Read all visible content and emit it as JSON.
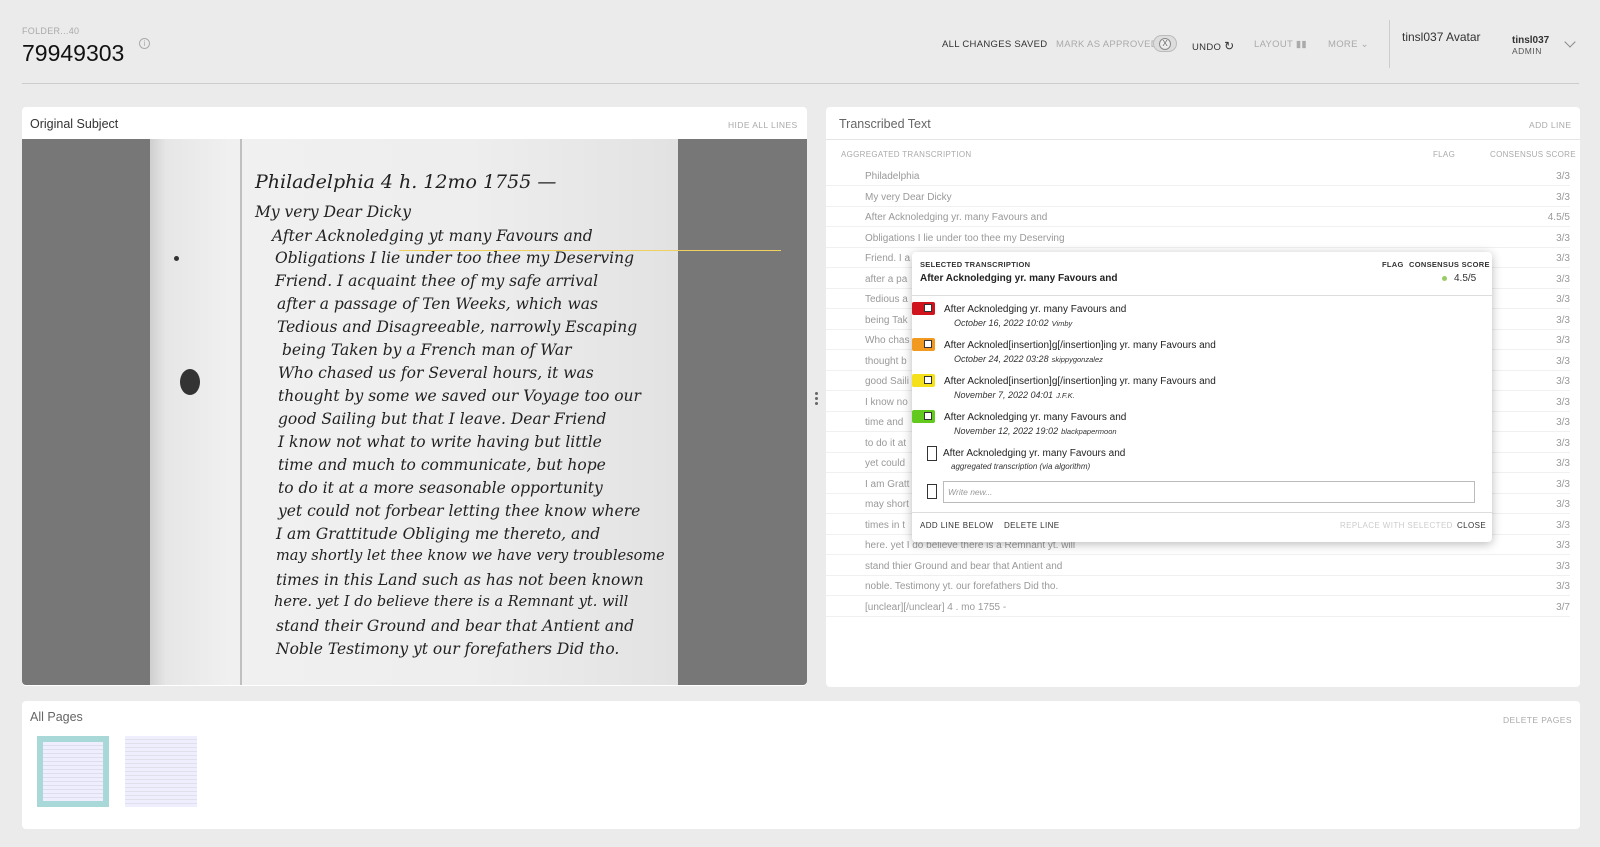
{
  "header": {
    "folder_label": "FOLDER...40",
    "subject_id": "79949303",
    "all_changes_saved": "ALL CHANGES SAVED",
    "mark_as_approved": "MARK AS APPROVED",
    "toggle_mark": "X",
    "undo": "UNDO",
    "layout": "LAYOUT",
    "more": "MORE",
    "avatar_alt": "tinsl037 Avatar",
    "username": "tinsl037",
    "role": "ADMIN"
  },
  "original_subject": {
    "title": "Original Subject",
    "hide_all_lines": "HIDE ALL LINES",
    "handwriting": [
      "Philadelphia     4 h. 12mo 1755 —",
      "My very Dear Dicky",
      "After Acknoledging yt many Favours and",
      "Obligations I lie under too thee my Deserving",
      "Friend. I acquaint thee of my safe arrival",
      "after a passage of Ten Weeks, which was",
      "Tedious and Disagreeable, narrowly Escaping",
      "being Taken by a French man of War",
      "Who chased us for Several hours, it was",
      "thought by some we saved our Voyage too our",
      "good Sailing but that I leave. Dear Friend",
      "I know not what to write having but little",
      "time and much to communicate, but hope",
      "to do it at a more seasonable opportunity",
      "yet could not forbear letting thee know where",
      "I am Grattitude Obliging me thereto, and",
      "may shortly let thee know we have very troublesome",
      "times in this Land such as has not been known",
      "here. yet I do believe there is a Remnant yt. will",
      "stand their Ground and bear that Antient and",
      "Noble Testimony yt our forefathers Did tho."
    ]
  },
  "transcribed_text": {
    "title": "Transcribed Text",
    "add_line": "ADD LINE",
    "col_aggregated": "AGGREGATED TRANSCRIPTION",
    "col_flag": "FLAG",
    "col_score": "CONSENSUS SCORE",
    "rows": [
      {
        "text": "Philadelphia",
        "score": "3/3"
      },
      {
        "text": "My very Dear Dicky",
        "score": "3/3"
      },
      {
        "text": "After Acknoledging yr. many Favours and",
        "score": "4.5/5"
      },
      {
        "text": "Obligations I lie under too thee my Deserving",
        "score": "3/3"
      },
      {
        "text": "Friend. I a",
        "score": "3/3"
      },
      {
        "text": "after a pa",
        "score": "3/3"
      },
      {
        "text": "Tedious a",
        "score": "3/3"
      },
      {
        "text": "being Tak",
        "score": "3/3"
      },
      {
        "text": "Who chas",
        "score": "3/3"
      },
      {
        "text": "thought b",
        "score": "3/3"
      },
      {
        "text": "good Saili",
        "score": "3/3"
      },
      {
        "text": "I know no",
        "score": "3/3"
      },
      {
        "text": "time and",
        "score": "3/3"
      },
      {
        "text": "to do it at",
        "score": "3/3"
      },
      {
        "text": "yet could",
        "score": "3/3"
      },
      {
        "text": "I am Gratt",
        "score": "3/3"
      },
      {
        "text": "may short",
        "score": "3/3"
      },
      {
        "text": "times in t",
        "score": "3/3"
      },
      {
        "text": "here. yet I do believe there is a Remnant yt. will",
        "score": "3/3"
      },
      {
        "text": "stand thier Ground and bear that Antient and",
        "score": "3/3"
      },
      {
        "text": "noble. Testimony yt. our forefathers Did tho.",
        "score": "3/3"
      },
      {
        "text": "[unclear][/unclear] 4 . mo 1755 -",
        "score": "3/7"
      }
    ]
  },
  "popup": {
    "label": "SELECTED TRANSCRIPTION",
    "flag": "FLAG",
    "consensus": "CONSENSUS SCORE",
    "selected_text": "After Acknoledging yr. many Favours and",
    "score": "4.5/5",
    "transcriptions": [
      {
        "text": "After Acknoledging yr. many Favours and",
        "date": "October 16, 2022 10:02",
        "user": "Vimby",
        "color": "#d0141e"
      },
      {
        "text": "After Acknoled[insertion]g[/insertion]ing yr. many Favours and",
        "date": "October 24, 2022 03:28",
        "user": "skippygonzalez",
        "color": "#f29a1f"
      },
      {
        "text": "After Acknoled[insertion]g[/insertion]ing yr. many Favours and",
        "date": "November 7, 2022 04:01",
        "user": "J.F.K.",
        "color": "#f5e01c"
      },
      {
        "text": "After Acknoledging yr. many Favours and",
        "date": "November 12, 2022 19:02",
        "user": "blackpapermoon",
        "color": "#62c91e"
      }
    ],
    "algorithm_text": "After Acknoledging yr. many Favours and",
    "algorithm_meta": "aggregated transcription (via algorithm)",
    "write_placeholder": "Write new...",
    "add_line_below": "ADD LINE BELOW",
    "delete_line": "DELETE LINE",
    "replace_with_selected": "REPLACE WITH SELECTED",
    "close": "CLOSE"
  },
  "all_pages": {
    "title": "All Pages",
    "delete_pages": "DELETE PAGES",
    "selected_color": "#a8d8d8"
  }
}
